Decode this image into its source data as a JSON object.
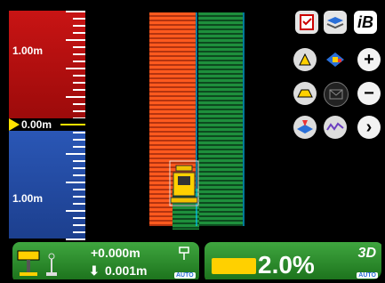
{
  "gauge": {
    "upper_label": "1.00m",
    "zero_label": "0.00m",
    "lower_label": "1.00m"
  },
  "icons": {
    "top": [
      "checklist-icon",
      "layers-icon",
      "ib-logo-icon"
    ],
    "row2": [
      "offset-icon",
      "surface-view-icon",
      "zoom-in-icon"
    ],
    "row3": [
      "design-surface-icon",
      "message-icon",
      "zoom-out-icon"
    ],
    "row4": [
      "bucket-icon",
      "profile-icon",
      "next-icon"
    ],
    "ib_text": "iB",
    "plus": "+",
    "minus": "−",
    "next": "›"
  },
  "bottom_left": {
    "cut_fill_value": "+0.000m",
    "secondary_value": "0.001m",
    "auto_label": "AUTO"
  },
  "bottom_right": {
    "slope_value": "2.0%",
    "mode_label": "3D",
    "auto_label": "AUTO"
  },
  "colors": {
    "cut_red": "#c81414",
    "fill_blue": "#2b58b8",
    "swath_orange": "#ff5a1e",
    "swath_green": "#1e8f3c",
    "panel_green": "#2e8f2e",
    "indicator_yellow": "#ffd000"
  }
}
